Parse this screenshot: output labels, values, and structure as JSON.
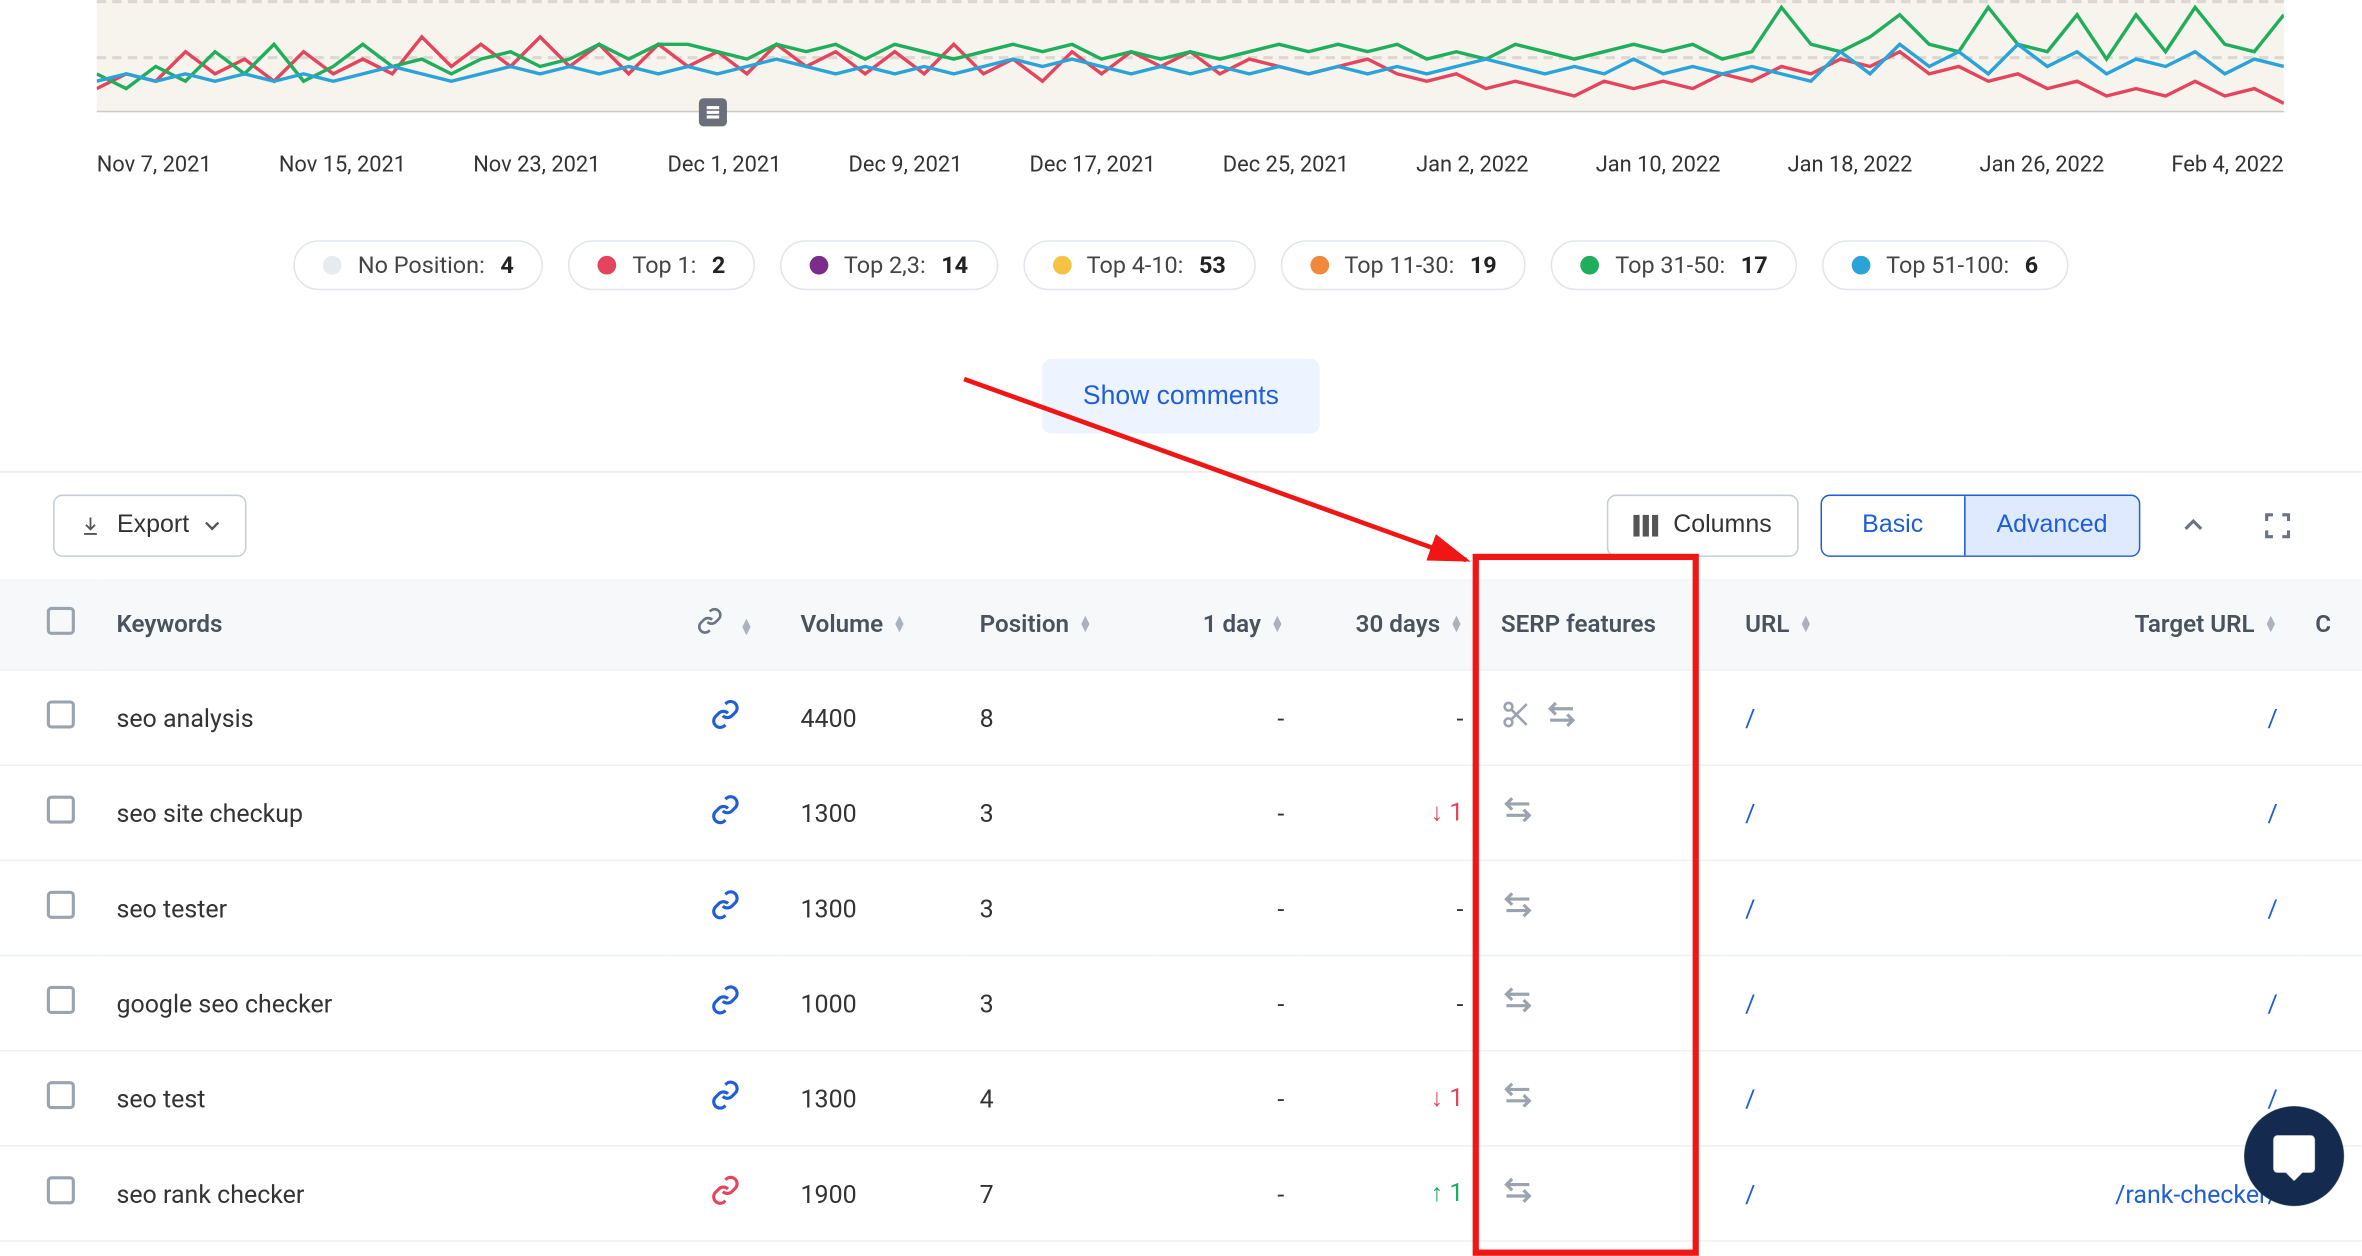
{
  "chart_data": {
    "type": "line",
    "y_ticks": [
      "10",
      "0"
    ],
    "x_labels": [
      "Nov 7, 2021",
      "Nov 15, 2021",
      "Nov 23, 2021",
      "Dec 1, 2021",
      "Dec 9, 2021",
      "Dec 17, 2021",
      "Dec 25, 2021",
      "Jan 2, 2022",
      "Jan 10, 2022",
      "Jan 18, 2022",
      "Jan 26, 2022",
      "Feb 4, 2022"
    ],
    "ylim": [
      0,
      15
    ],
    "series": [
      {
        "name": "red",
        "color": "#e5455c",
        "values": [
          3,
          5,
          4,
          8,
          5,
          7,
          4,
          8,
          5,
          7,
          5,
          10,
          6,
          9,
          6,
          10,
          6,
          9,
          5,
          9,
          6,
          8,
          5,
          9,
          6,
          8,
          5,
          8,
          5,
          9,
          5,
          7,
          4,
          8,
          5,
          8,
          6,
          8,
          5,
          7,
          6,
          5,
          6,
          7,
          5,
          4,
          5,
          3,
          4,
          3,
          2,
          4,
          3,
          4,
          3,
          5,
          4,
          6,
          5,
          7,
          6,
          8,
          5,
          6,
          4,
          5,
          3,
          4,
          2,
          3,
          2,
          4,
          2,
          3,
          1
        ]
      },
      {
        "name": "green",
        "color": "#1fae5c",
        "values": [
          5,
          3,
          6,
          4,
          8,
          5,
          9,
          4,
          6,
          9,
          6,
          7,
          5,
          7,
          8,
          6,
          7,
          9,
          7,
          9,
          9,
          8,
          7,
          9,
          8,
          9,
          7,
          9,
          8,
          7,
          8,
          9,
          8,
          9,
          7,
          8,
          7,
          8,
          7,
          8,
          9,
          8,
          9,
          8,
          9,
          7,
          8,
          7,
          9,
          8,
          7,
          8,
          9,
          8,
          9,
          7,
          8,
          14,
          9,
          8,
          10,
          13,
          9,
          8,
          14,
          9,
          8,
          13,
          7,
          13,
          8,
          14,
          9,
          8,
          13
        ]
      },
      {
        "name": "blue",
        "color": "#2aa3d9",
        "values": [
          4,
          5,
          4,
          5,
          4,
          5,
          4,
          5,
          4,
          5,
          6,
          5,
          4,
          5,
          6,
          5,
          6,
          5,
          6,
          5,
          6,
          5,
          6,
          7,
          6,
          5,
          6,
          5,
          6,
          5,
          6,
          7,
          6,
          7,
          6,
          5,
          6,
          5,
          6,
          5,
          6,
          5,
          6,
          5,
          6,
          5,
          6,
          7,
          6,
          5,
          6,
          5,
          7,
          5,
          6,
          5,
          6,
          5,
          4,
          8,
          5,
          9,
          6,
          8,
          5,
          9,
          6,
          8,
          5,
          7,
          6,
          8,
          5,
          7,
          6
        ]
      }
    ]
  },
  "legend": [
    {
      "color": "#e7eaef",
      "label": "No Position:",
      "value": "4"
    },
    {
      "color": "#e5455c",
      "label": "Top 1:",
      "value": "2"
    },
    {
      "color": "#7a2e8a",
      "label": "Top 2,3:",
      "value": "14"
    },
    {
      "color": "#f6c244",
      "label": "Top 4-10:",
      "value": "53"
    },
    {
      "color": "#f0883e",
      "label": "Top 11-30:",
      "value": "19"
    },
    {
      "color": "#1fae5c",
      "label": "Top 31-50:",
      "value": "17"
    },
    {
      "color": "#2aa3d9",
      "label": "Top 51-100:",
      "value": "6"
    }
  ],
  "buttons": {
    "show_comments": "Show comments",
    "export": "Export",
    "columns": "Columns",
    "basic": "Basic",
    "advanced": "Advanced"
  },
  "headers": {
    "keywords": "Keywords",
    "volume": "Volume",
    "position": "Position",
    "day1": "1 day",
    "days30": "30 days",
    "serp": "SERP features",
    "url": "URL",
    "target": "Target URL",
    "cut": "C"
  },
  "rows": [
    {
      "kw": "seo analysis",
      "link_red": false,
      "vol": "4400",
      "pos": "8",
      "d1": "-",
      "d30": "-",
      "d30_dir": "none",
      "serp": [
        "cut",
        "swap"
      ],
      "url": "/",
      "target": "/"
    },
    {
      "kw": "seo site checkup",
      "link_red": false,
      "vol": "1300",
      "pos": "3",
      "d1": "-",
      "d30": "1",
      "d30_dir": "down",
      "serp": [
        "swap"
      ],
      "url": "/",
      "target": "/"
    },
    {
      "kw": "seo tester",
      "link_red": false,
      "vol": "1300",
      "pos": "3",
      "d1": "-",
      "d30": "-",
      "d30_dir": "none",
      "serp": [
        "swap"
      ],
      "url": "/",
      "target": "/"
    },
    {
      "kw": "google seo checker",
      "link_red": false,
      "vol": "1000",
      "pos": "3",
      "d1": "-",
      "d30": "-",
      "d30_dir": "none",
      "serp": [
        "swap"
      ],
      "url": "/",
      "target": "/"
    },
    {
      "kw": "seo test",
      "link_red": false,
      "vol": "1300",
      "pos": "4",
      "d1": "-",
      "d30": "1",
      "d30_dir": "down",
      "serp": [
        "swap"
      ],
      "url": "/",
      "target": "/"
    },
    {
      "kw": "seo rank checker",
      "link_red": true,
      "vol": "1900",
      "pos": "7",
      "d1": "-",
      "d30": "1",
      "d30_dir": "up",
      "serp": [
        "swap"
      ],
      "url": "/",
      "target": "/rank-checker/"
    }
  ]
}
